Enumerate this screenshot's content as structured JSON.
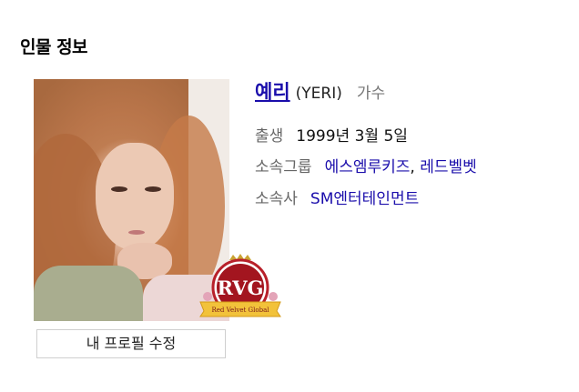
{
  "section_title": "인물 정보",
  "profile": {
    "name": "예리",
    "english_name": "(YERI)",
    "occupation": "가수",
    "birth_label": "출생",
    "birth_value": "1999년 3월 5일",
    "group_label": "소속그룹",
    "groups": [
      "에스엠루키즈",
      "레드벨벳"
    ],
    "group_separator": ",",
    "agency_label": "소속사",
    "agency_value": "SM엔터테인먼트"
  },
  "badge": {
    "text": "RVG",
    "ribbon_text": "Red Velvet Global"
  },
  "edit_button_label": "내 프로필 수정",
  "colors": {
    "link": "#1a0dab",
    "label": "#666666",
    "muted": "#777777"
  }
}
